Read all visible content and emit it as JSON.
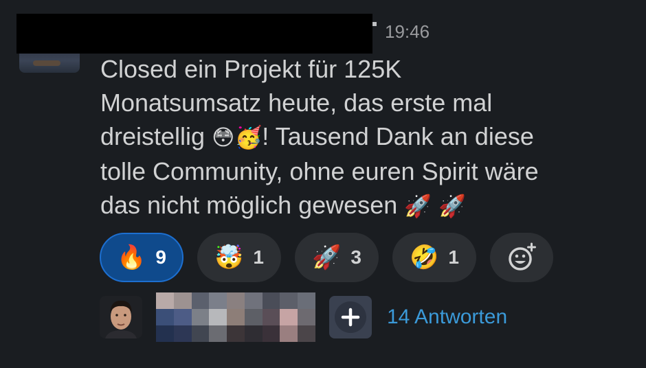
{
  "message": {
    "timestamp": "19:46",
    "line1": "Closed ein Projekt für 125K",
    "line2": "Monatsumsatz heute, das erste mal",
    "line3_before_emoji": "dreistellig ",
    "emoji_flushed": "😳",
    "emoji_party": "🥳",
    "line3_after_emoji": "!  Tausend Dank an diese",
    "line4": "tolle Community, ohne euren Spirit wäre",
    "line5": "das nicht möglich gewesen ",
    "emoji_rocket": "🚀",
    "emoji_space": " "
  },
  "reactions": [
    {
      "emoji": "🔥",
      "count": "9",
      "active": true
    },
    {
      "emoji": "🤯",
      "count": "1",
      "active": false
    },
    {
      "emoji": "🚀",
      "count": "3",
      "active": false
    },
    {
      "emoji": "🤣",
      "count": "1",
      "active": false
    }
  ],
  "add_reaction": {
    "icon": "add-emoji-icon"
  },
  "thread": {
    "replies_label": "14 Antworten"
  },
  "colors": {
    "background": "#1a1d21",
    "active_reaction": "#0f4a8c",
    "link": "#3b9ad9"
  }
}
